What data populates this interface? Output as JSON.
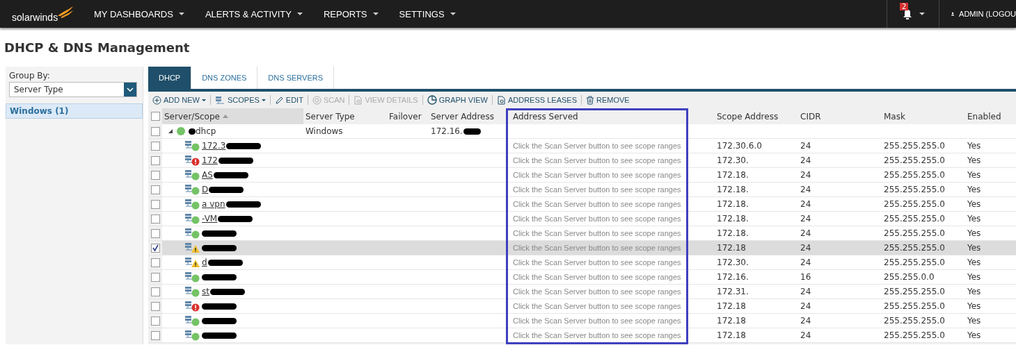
{
  "nav": {
    "logo": "solarwinds",
    "menus": [
      {
        "label": "MY DASHBOARDS"
      },
      {
        "label": "ALERTS & ACTIVITY"
      },
      {
        "label": "REPORTS"
      },
      {
        "label": "SETTINGS"
      }
    ],
    "notification_count": "2",
    "user": "ADMIN (LOGOU"
  },
  "title": "DHCP & DNS Management",
  "sidebar": {
    "group_by_label": "Group By:",
    "group_by_value": "Server Type",
    "groups": [
      {
        "label": "Windows (1)",
        "selected": true
      }
    ]
  },
  "tabs": [
    {
      "label": "DHCP",
      "selected": true
    },
    {
      "label": "DNS ZONES",
      "selected": false
    },
    {
      "label": "DNS SERVERS",
      "selected": false
    }
  ],
  "toolbar": [
    {
      "kind": "add",
      "label": "ADD NEW",
      "dropdown": true,
      "disabled": false
    },
    {
      "kind": "scopes",
      "label": "SCOPES",
      "dropdown": true,
      "disabled": false
    },
    {
      "kind": "edit",
      "label": "EDIT",
      "dropdown": false,
      "disabled": false
    },
    {
      "kind": "scan",
      "label": "SCAN",
      "dropdown": false,
      "disabled": true
    },
    {
      "kind": "details",
      "label": "VIEW DETAILS",
      "dropdown": false,
      "disabled": true
    },
    {
      "kind": "graph",
      "label": "GRAPH VIEW",
      "dropdown": false,
      "disabled": false
    },
    {
      "kind": "leases",
      "label": "ADDRESS LEASES",
      "dropdown": false,
      "disabled": false
    },
    {
      "kind": "remove",
      "label": "REMOVE",
      "dropdown": false,
      "disabled": false
    }
  ],
  "table": {
    "select_all_checked": false,
    "columns": [
      {
        "label": "Server/Scope",
        "sorted": true
      },
      {
        "label": "Server Type",
        "sorted": false
      },
      {
        "label": "Failover",
        "sorted": false
      },
      {
        "label": "Server Address",
        "sorted": false
      },
      {
        "label": "Address Served",
        "sorted": false
      },
      {
        "label": "Scope Address",
        "sorted": false
      },
      {
        "label": "CIDR",
        "sorted": false
      },
      {
        "label": "Mask",
        "sorted": false
      },
      {
        "label": "Enabled",
        "sorted": false
      }
    ],
    "server": {
      "name": "dhcp",
      "type": "Windows",
      "address": "172.16.",
      "expanded": true,
      "checked": false
    },
    "scopes": [
      {
        "name": "172.3",
        "kind": "up",
        "checked": false,
        "served": "Click the Scan Server button to see scope ranges",
        "scope_address": "172.30.6.0",
        "cidr": "24",
        "mask": "255.255.255.0",
        "enabled": "Yes"
      },
      {
        "name": "172",
        "kind": "error",
        "checked": false,
        "served": "Click the Scan Server button to see scope ranges",
        "scope_address": "172.30.",
        "cidr": "24",
        "mask": "255.255.255.0",
        "enabled": "Yes"
      },
      {
        "name": "AS",
        "kind": "up",
        "checked": false,
        "served": "Click the Scan Server button to see scope ranges",
        "scope_address": "172.18.",
        "cidr": "24",
        "mask": "255.255.255.0",
        "enabled": "Yes"
      },
      {
        "name": "D",
        "kind": "up",
        "checked": false,
        "served": "Click the Scan Server button to see scope ranges",
        "scope_address": "172.18.",
        "cidr": "24",
        "mask": "255.255.255.0",
        "enabled": "Yes"
      },
      {
        "name": "a vpn",
        "kind": "up",
        "checked": false,
        "served": "Click the Scan Server button to see scope ranges",
        "scope_address": "172.18.",
        "cidr": "24",
        "mask": "255.255.255.0",
        "enabled": "Yes"
      },
      {
        "name": "-VM",
        "kind": "up",
        "checked": false,
        "served": "Click the Scan Server button to see scope ranges",
        "scope_address": "172.18.",
        "cidr": "24",
        "mask": "255.255.255.0",
        "enabled": "Yes"
      },
      {
        "kind": "up",
        "checked": false,
        "served": "Click the Scan Server button to see scope ranges",
        "scope_address": "172.18.",
        "cidr": "24",
        "mask": "255.255.255.0",
        "enabled": "Yes"
      },
      {
        "kind": "warning",
        "checked": true,
        "served": "Click the Scan Server button to see scope ranges",
        "scope_address": "172.18",
        "cidr": "24",
        "mask": "255.255.255.0",
        "enabled": "Yes"
      },
      {
        "name": "d",
        "kind": "warning",
        "checked": false,
        "served": "Click the Scan Server button to see scope ranges",
        "scope_address": "172.30.",
        "cidr": "24",
        "mask": "255.255.255.0",
        "enabled": "Yes"
      },
      {
        "kind": "up",
        "checked": false,
        "served": "Click the Scan Server button to see scope ranges",
        "scope_address": "172.16.",
        "cidr": "16",
        "mask": "255.255.0.0",
        "enabled": "Yes"
      },
      {
        "name": "st",
        "kind": "up",
        "checked": false,
        "served": "Click the Scan Server button to see scope ranges",
        "scope_address": "172.31.",
        "cidr": "24",
        "mask": "255.255.255.0",
        "enabled": "Yes"
      },
      {
        "kind": "error",
        "checked": false,
        "served": "Click the Scan Server button to see scope ranges",
        "scope_address": "172.18",
        "cidr": "24",
        "mask": "255.255.255.0",
        "enabled": "Yes"
      },
      {
        "kind": "up",
        "checked": false,
        "served": "Click the Scan Server button to see scope ranges",
        "scope_address": "172.18",
        "cidr": "24",
        "mask": "255.255.255.0",
        "enabled": "Yes"
      },
      {
        "kind": "up",
        "checked": false,
        "served": "Click the Scan Server button to see scope ranges",
        "scope_address": "172.18",
        "cidr": "24",
        "mask": "255.255.255.0",
        "enabled": "Yes"
      }
    ]
  }
}
